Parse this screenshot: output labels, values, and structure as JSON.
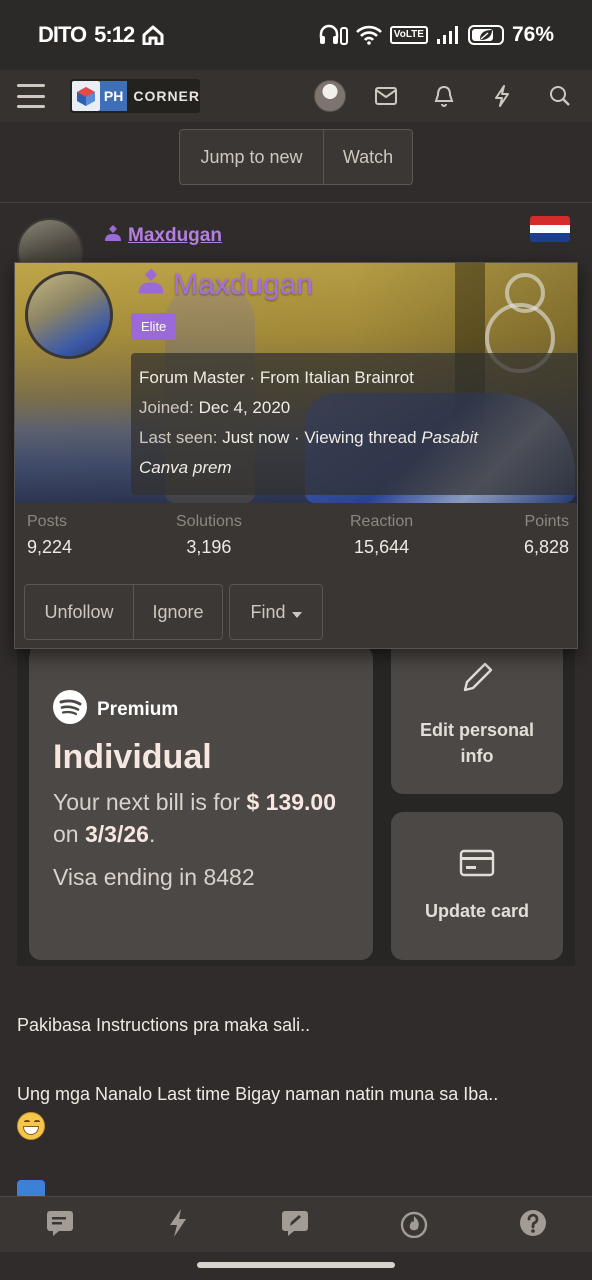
{
  "status_bar": {
    "carrier": "DITO",
    "time": "5:12",
    "volte": "VoLTE",
    "battery": "76%",
    "battery_level": 0.76
  },
  "nav": {
    "logo_ph": "PH",
    "logo_corner": "CORNER",
    "icons": [
      "menu-icon",
      "avatar",
      "mail-icon",
      "bell-icon",
      "bolt-icon",
      "search-icon"
    ]
  },
  "thread_controls": {
    "jump_label": "Jump to new",
    "watch_label": "Watch"
  },
  "post": {
    "username": "Maxdugan",
    "flag_colors": [
      "#d42b2b",
      "#ffffff",
      "#1d3e8f"
    ]
  },
  "popup": {
    "username": "Maxdugan",
    "badge": "Elite",
    "title_line": "Forum Master · From Italian Brainrot",
    "joined_label": "Joined:",
    "joined_value": "Dec 4, 2020",
    "last_seen_label": "Last seen:",
    "last_seen_value": "Just now · Viewing thread",
    "thread_name_1": "Pasabit",
    "thread_name_2": "Canva prem",
    "stats": [
      {
        "label": "Posts",
        "value": "9,224"
      },
      {
        "label": "Solutions",
        "value": "3,196"
      },
      {
        "label": "Reaction",
        "value": "15,644"
      },
      {
        "label": "Points",
        "value": "6,828"
      }
    ],
    "actions": {
      "unfollow": "Unfollow",
      "ignore": "Ignore",
      "find": "Find"
    },
    "name_color": "#a86ee0",
    "badge_color": "#9a6ad8"
  },
  "embed": {
    "premium_label": "Premium",
    "plan_name": "Individual",
    "bill_prefix": "Your next bill is for",
    "bill_currency": "$",
    "bill_amount": "139.00",
    "bill_on": "on",
    "bill_date": "3/3/26",
    "bill_period": ".",
    "visa_text": "Visa ending in 8482",
    "edit_info_label": "Edit personal info",
    "update_card_label": "Update card"
  },
  "post_body": {
    "line1": "Pakibasa Instructions pra maka sali..",
    "line2": "Ung mga Nanalo Last time Bigay naman natin muna sa Iba.."
  },
  "bottom_nav": {
    "icons": [
      "forums-icon",
      "whats-new-icon",
      "new-post-icon",
      "trending-icon",
      "help-icon"
    ]
  }
}
